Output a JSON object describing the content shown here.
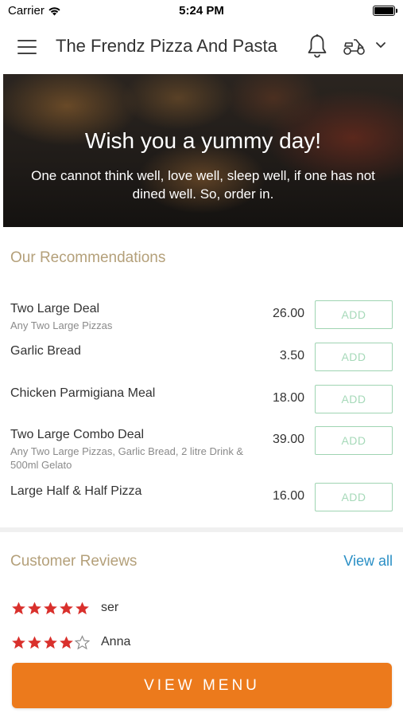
{
  "status_bar": {
    "carrier": "Carrier",
    "time": "5:24 PM"
  },
  "header": {
    "title": "The Frendz Pizza And Pasta"
  },
  "hero": {
    "title": "Wish you a yummy day!",
    "subtitle": "One cannot think well, love well, sleep well, if one has not dined well. So, order in."
  },
  "recommendations": {
    "title": "Our Recommendations",
    "add_label": "ADD",
    "items": [
      {
        "name": "Two Large Deal",
        "description": "Any Two Large Pizzas",
        "price": "26.00"
      },
      {
        "name": "Garlic Bread",
        "description": "",
        "price": "3.50"
      },
      {
        "name": "Chicken Parmigiana Meal",
        "description": "",
        "price": "18.00"
      },
      {
        "name": "Two Large Combo Deal",
        "description": "Any Two Large Pizzas, Garlic Bread, 2 litre Drink & 500ml Gelato",
        "price": "39.00"
      },
      {
        "name": "Large Half & Half Pizza",
        "description": "",
        "price": "16.00"
      }
    ]
  },
  "reviews": {
    "title": "Customer Reviews",
    "view_all": "View all",
    "items": [
      {
        "name": "ser",
        "rating": 5
      },
      {
        "name": "Anna",
        "rating": 4
      }
    ]
  },
  "footer": {
    "view_menu": "VIEW MENU"
  },
  "colors": {
    "accent": "#ec7a1c",
    "add_border": "#9fd4b2",
    "section_title": "#b4a07a",
    "link": "#2a8fc5",
    "star": "#d9302c"
  }
}
